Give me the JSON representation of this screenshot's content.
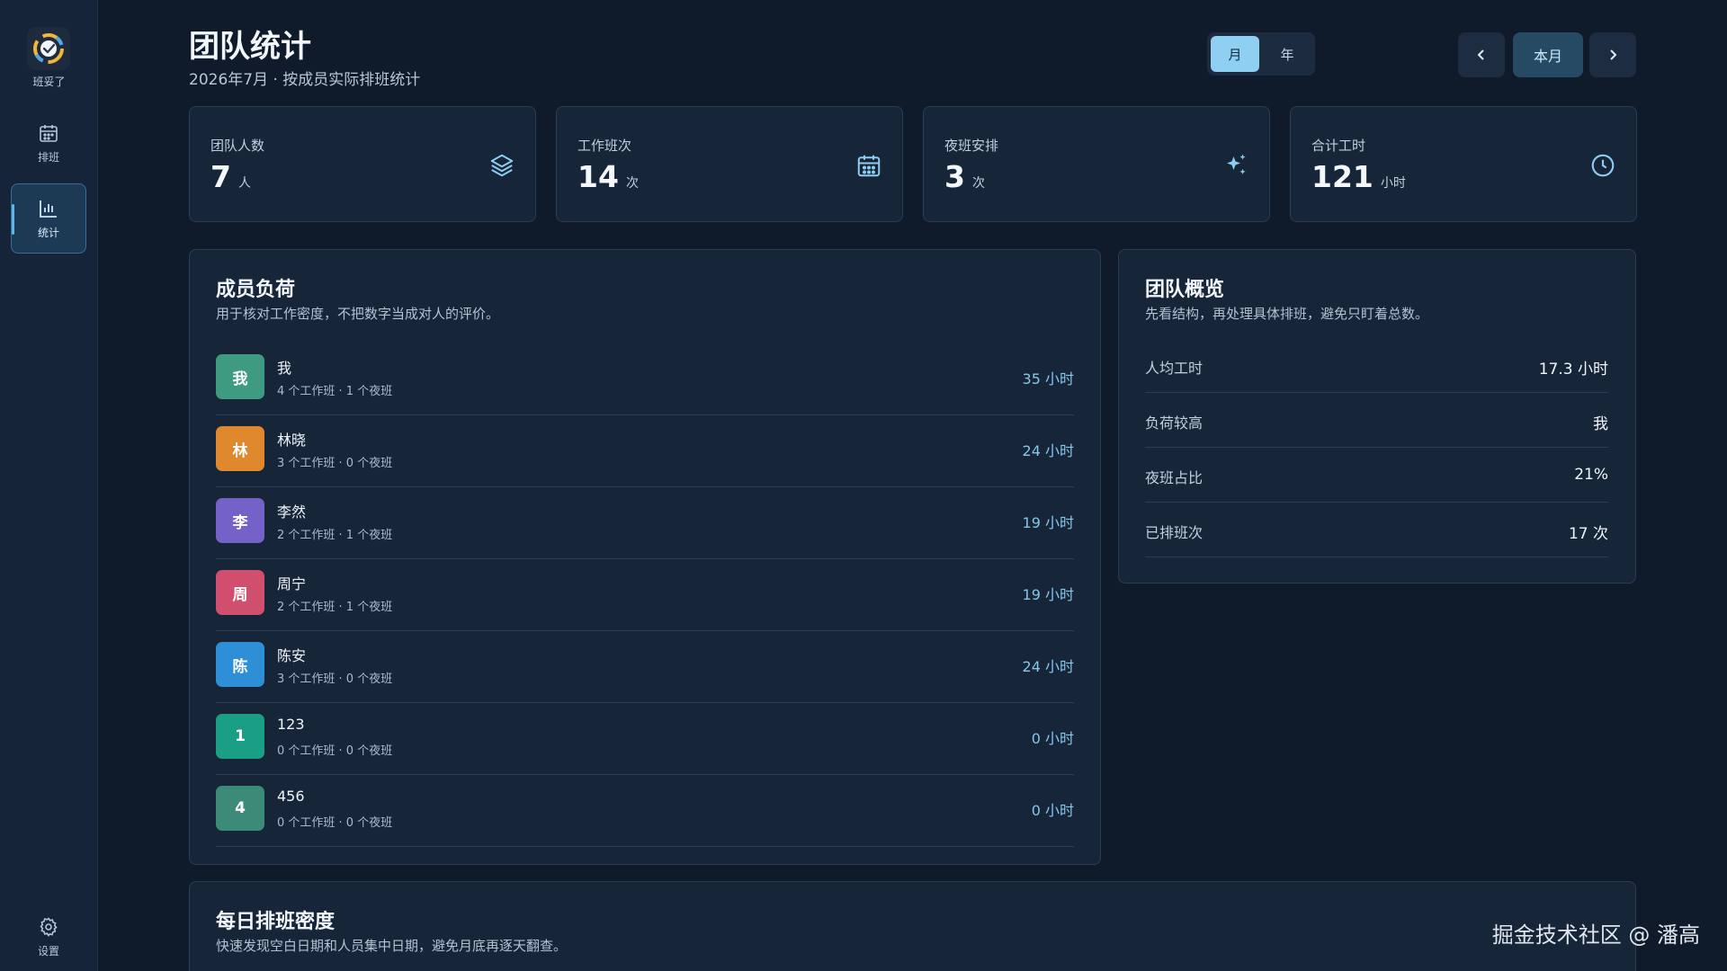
{
  "sidebar": {
    "app_name": "班妥了",
    "items": [
      {
        "label": "排班",
        "icon": "calendar-icon"
      },
      {
        "label": "统计",
        "icon": "bar-chart-icon"
      },
      {
        "label": "设置",
        "icon": "gear-icon"
      }
    ]
  },
  "header": {
    "title": "团队统计",
    "subtitle": "2026年7月 · 按成员实际排班统计",
    "period_month": "月",
    "period_year": "年",
    "prev_icon": "chevron-left-icon",
    "current_label": "本月",
    "next_icon": "chevron-right-icon"
  },
  "stats": [
    {
      "label": "团队人数",
      "value": "7",
      "unit": "人",
      "icon": "layers-icon"
    },
    {
      "label": "工作班次",
      "value": "14",
      "unit": "次",
      "icon": "calendar-icon"
    },
    {
      "label": "夜班安排",
      "value": "3",
      "unit": "次",
      "icon": "sparkle-icon"
    },
    {
      "label": "合计工时",
      "value": "121",
      "unit": "小时",
      "icon": "clock-icon"
    }
  ],
  "members_panel": {
    "title": "成员负荷",
    "desc": "用于核对工作密度，不把数字当成对人的评价。",
    "members": [
      {
        "initial": "我",
        "name": "我",
        "detail": "4 个工作班 · 1 个夜班",
        "hours": "35 小时",
        "color": "#3f9a82"
      },
      {
        "initial": "林",
        "name": "林晓",
        "detail": "3 个工作班 · 0 个夜班",
        "hours": "24 小时",
        "color": "#e0882e"
      },
      {
        "initial": "李",
        "name": "李然",
        "detail": "2 个工作班 · 1 个夜班",
        "hours": "19 小时",
        "color": "#7562c8"
      },
      {
        "initial": "周",
        "name": "周宁",
        "detail": "2 个工作班 · 1 个夜班",
        "hours": "19 小时",
        "color": "#d04f6e"
      },
      {
        "initial": "陈",
        "name": "陈安",
        "detail": "3 个工作班 · 0 个夜班",
        "hours": "24 小时",
        "color": "#2f8fd6"
      },
      {
        "initial": "1",
        "name": "123",
        "detail": "0 个工作班 · 0 个夜班",
        "hours": "0 小时",
        "color": "#1a9f86"
      },
      {
        "initial": "4",
        "name": "456",
        "detail": "0 个工作班 · 0 个夜班",
        "hours": "0 小时",
        "color": "#3c8a78"
      }
    ]
  },
  "overview_panel": {
    "title": "团队概览",
    "desc": "先看结构，再处理具体排班，避免只盯着总数。",
    "rows": [
      {
        "label": "人均工时",
        "value": "17.3 小时"
      },
      {
        "label": "负荷较高",
        "value": "我"
      },
      {
        "label": "夜班占比",
        "value": "21%"
      },
      {
        "label": "已排班次",
        "value": "17 次"
      }
    ]
  },
  "density_panel": {
    "title": "每日排班密度",
    "desc": "快速发现空白日期和人员集中日期，避免月底再逐天翻查。"
  },
  "watermark": "掘金技术社区 @ 潘高"
}
